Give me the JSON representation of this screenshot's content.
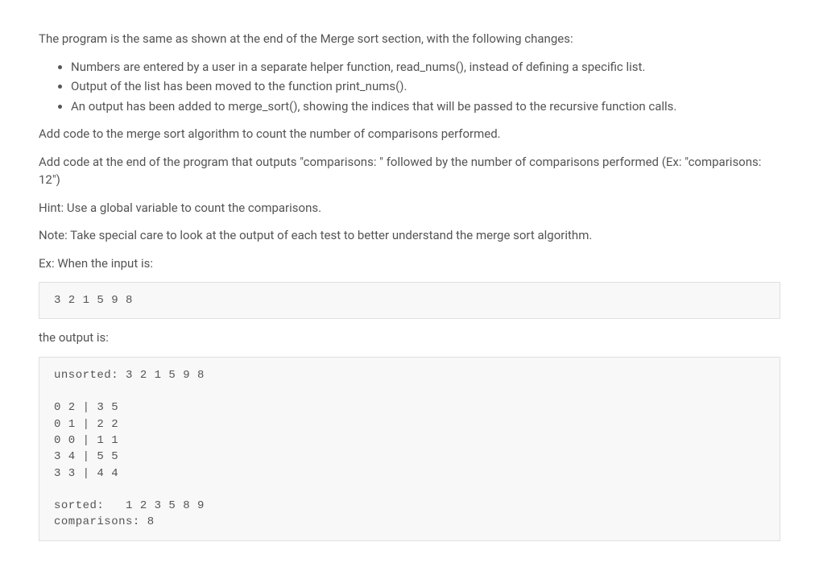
{
  "intro": "The program is the same as shown at the end of the Merge sort section, with the following changes:",
  "bullets": [
    "Numbers are entered by a user in a separate helper function, read_nums(), instead of defining a specific list.",
    "Output of the list has been moved to the function print_nums().",
    "An output has been added to merge_sort(), showing the indices that will be passed to the recursive function calls."
  ],
  "para_add_count": "Add code to the merge sort algorithm to count the number of comparisons performed.",
  "para_add_output": "Add code at the end of the program that outputs \"comparisons: \" followed by the number of comparisons performed (Ex: \"comparisons: 12\")",
  "para_hint": "Hint: Use a global variable to count the comparisons.",
  "para_note": "Note: Take special care to look at the output of each test to better understand the merge sort algorithm.",
  "para_ex": "Ex: When the input is:",
  "input_block": "3 2 1 5 9 8",
  "output_label": "the output is:",
  "output_block": "unsorted: 3 2 1 5 9 8\n\n0 2 | 3 5\n0 1 | 2 2\n0 0 | 1 1\n3 4 | 5 5\n3 3 | 4 4\n\nsorted:   1 2 3 5 8 9\ncomparisons: 8"
}
